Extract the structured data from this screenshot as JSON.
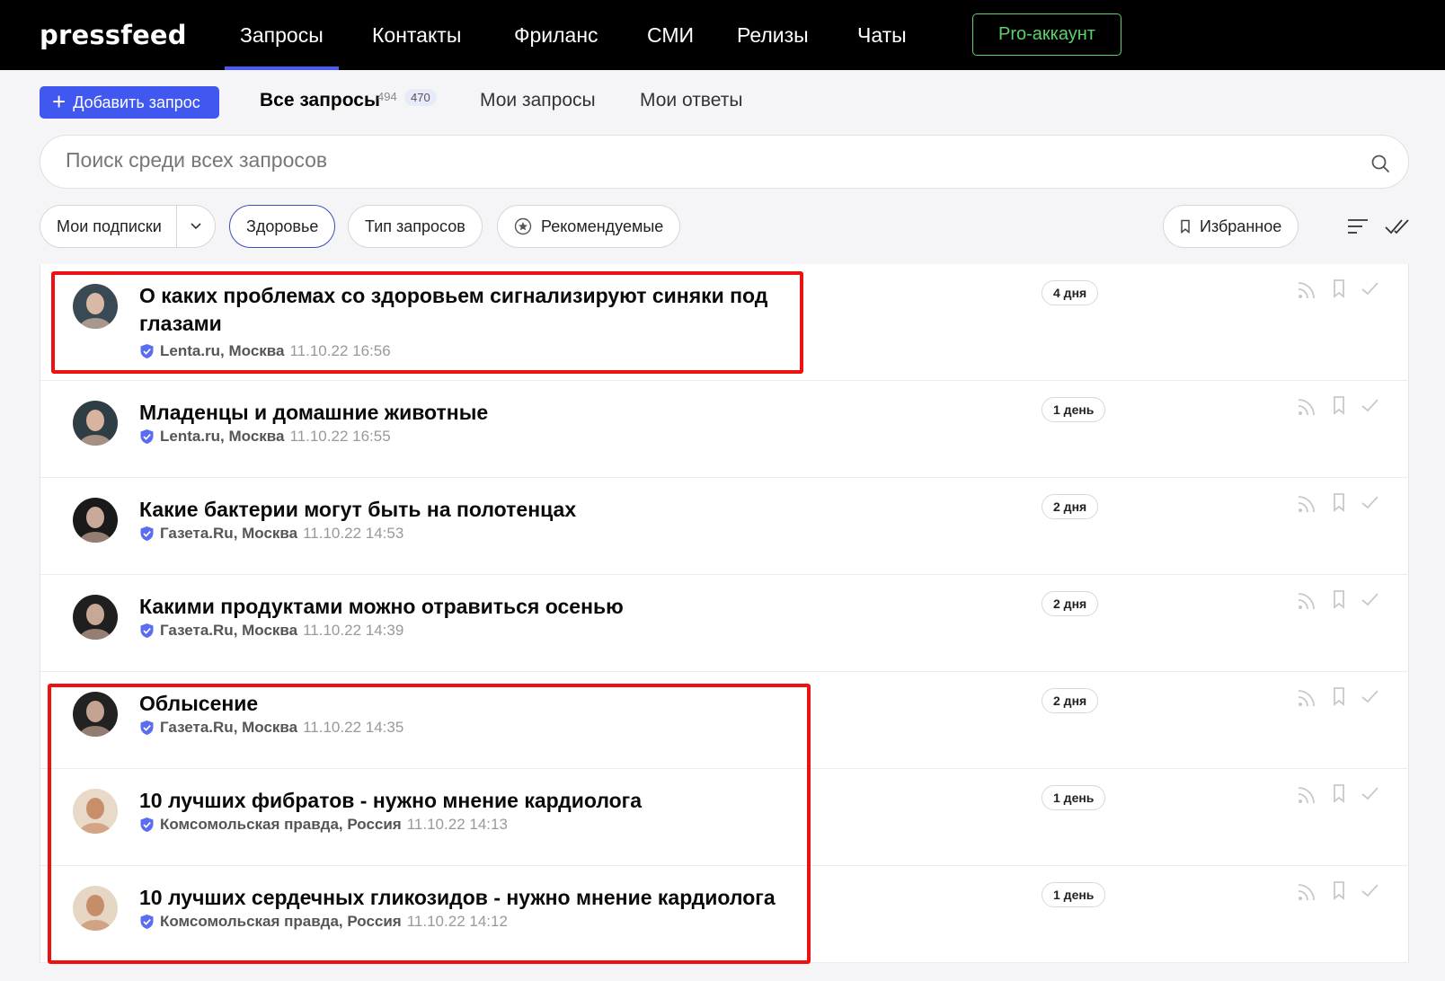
{
  "brand": {
    "logo": "pressfeed"
  },
  "nav": {
    "items": [
      "Запросы",
      "Контакты",
      "Фриланс",
      "СМИ",
      "Релизы",
      "Чаты"
    ],
    "pro_label": "Pro-аккаунт"
  },
  "tabs": {
    "add_label": "Добавить запрос",
    "all_label": "Все запросы",
    "all_count": "494",
    "all_badge": "470",
    "mine_label": "Мои запросы",
    "answers_label": "Мои ответы"
  },
  "search": {
    "placeholder": "Поиск среди всех запросов",
    "value": ""
  },
  "filters": {
    "subscriptions": "Мои подписки",
    "health": "Здоровье",
    "type": "Тип запросов",
    "recommended": "Рекомендуемые",
    "favorites": "Избранное"
  },
  "colors": {
    "accent": "#4058f0",
    "pro": "#5dd16b",
    "highlight": "#ee1111",
    "verified": "#5a6cf0"
  },
  "requests": [
    {
      "title": "О каких проблемах со здоровьем сигнализируют синяки под глазами",
      "source": "Lenta.ru, Москва",
      "time": "11.10.22 16:56",
      "days": "4 дня"
    },
    {
      "title": "Младенцы и домашние животные",
      "source": "Lenta.ru, Москва",
      "time": "11.10.22 16:55",
      "days": "1 день"
    },
    {
      "title": "Какие бактерии могут быть на полотенцах",
      "source": "Газета.Ru, Москва",
      "time": "11.10.22 14:53",
      "days": "2 дня"
    },
    {
      "title": "Какими продуктами можно отравиться осенью",
      "source": "Газета.Ru, Москва",
      "time": "11.10.22 14:39",
      "days": "2 дня"
    },
    {
      "title": "Облысение",
      "source": "Газета.Ru, Москва",
      "time": "11.10.22 14:35",
      "days": "2 дня"
    },
    {
      "title": "10 лучших фибратов - нужно мнение кардиолога",
      "source": "Комсомольская правда, Россия",
      "time": "11.10.22 14:13",
      "days": "1 день"
    },
    {
      "title": "10 лучших сердечных гликозидов - нужно мнение кардиолога",
      "source": "Комсомольская правда, Россия",
      "time": "11.10.22 14:12",
      "days": "1 день"
    }
  ]
}
